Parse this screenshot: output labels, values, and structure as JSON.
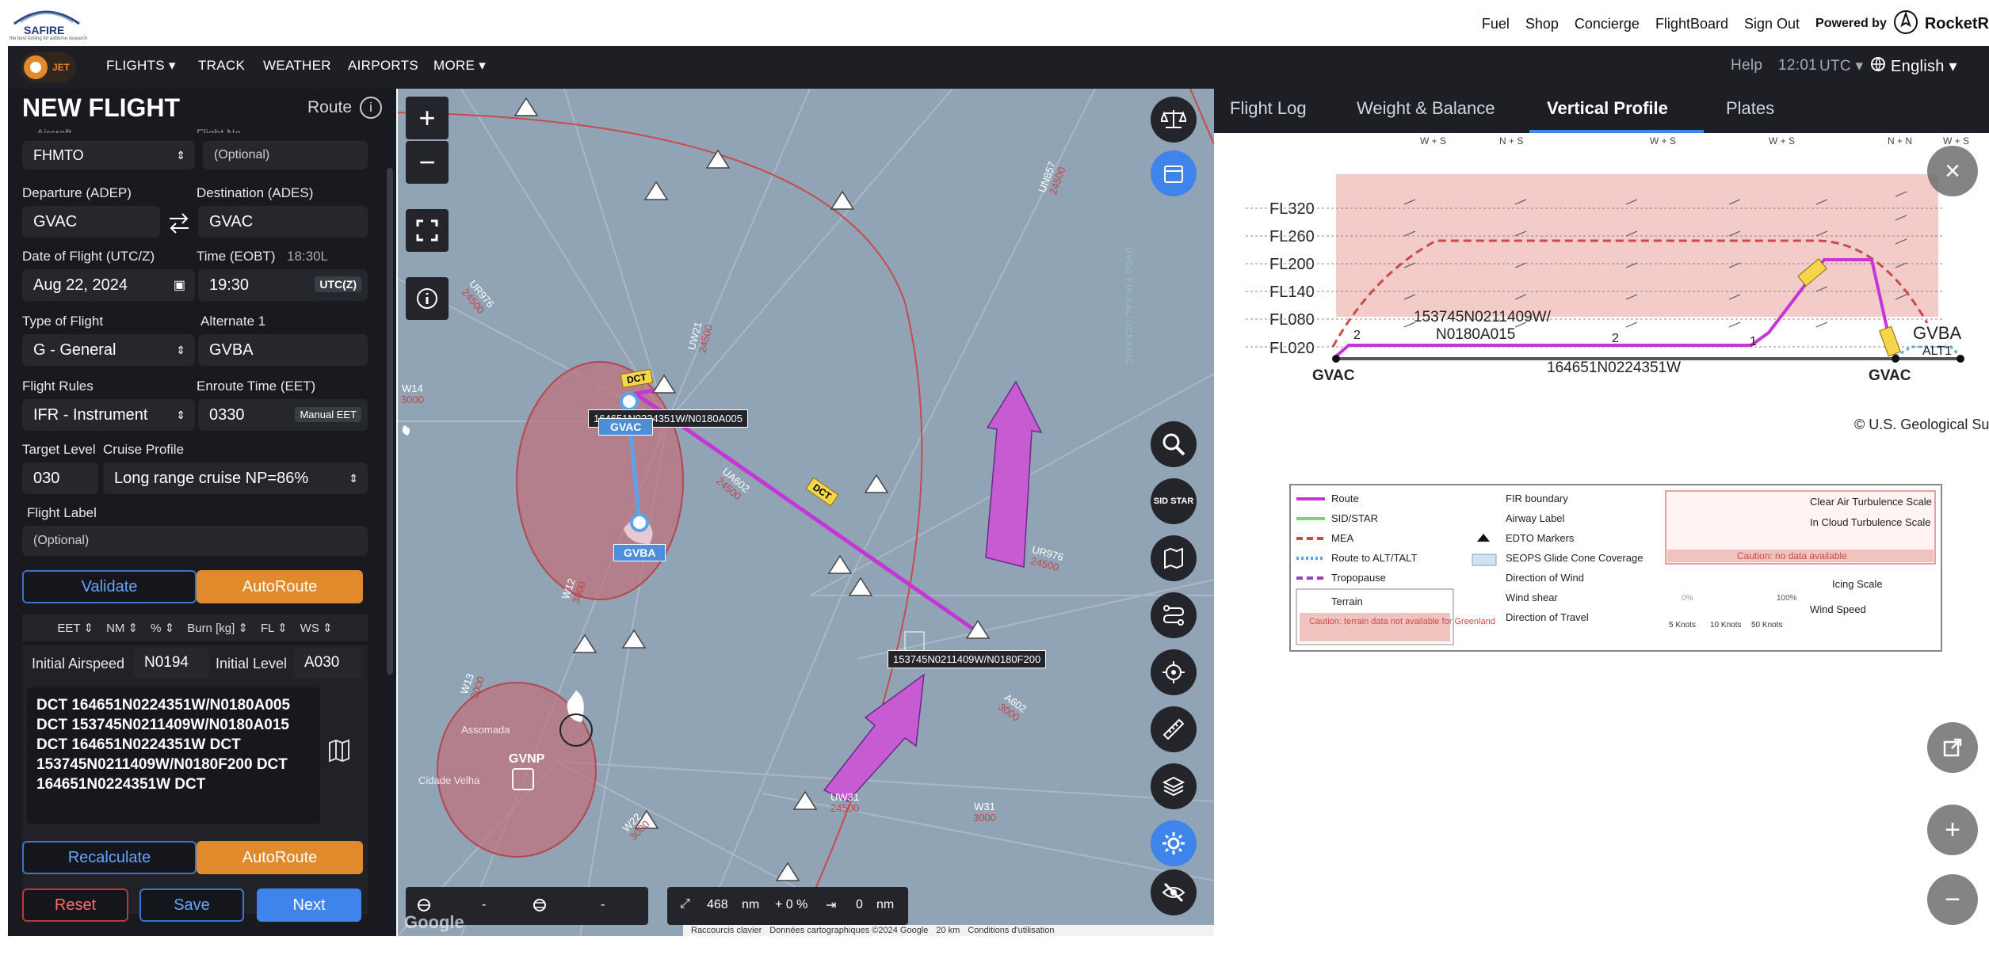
{
  "header": {
    "logo_text": "SAFIRE",
    "logo_sub": "the best tooling for airborne research",
    "links": [
      "Fuel",
      "Shop",
      "Concierge",
      "FlightBoard",
      "Sign Out"
    ],
    "powered_by": "Powered by",
    "brand": "RocketR"
  },
  "nav": {
    "logo_label": "JET",
    "items": [
      "FLIGHTS ▾",
      "TRACK",
      "WEATHER",
      "AIRPORTS",
      "MORE ▾"
    ],
    "help": "Help",
    "time": "12:01",
    "tz": "UTC ▾",
    "language": "English ▾"
  },
  "form": {
    "title": "NEW FLIGHT",
    "route_label": "Route",
    "aircraft_label": "Aircraft",
    "aircraft": "FHMTO",
    "flightno_label": "Flight No",
    "flightno_placeholder": "(Optional)",
    "departure_label": "Departure (ADEP)",
    "departure": "GVAC",
    "destination_label": "Destination (ADES)",
    "destination": "GVAC",
    "date_label": "Date of Flight (UTC/Z)",
    "date": "Aug 22, 2024",
    "time_label": "Time (EOBT)",
    "time_local": "18:30L",
    "time": "19:30",
    "time_unit": "UTC(Z)",
    "type_label": "Type of Flight",
    "type": "G - General",
    "alternate_label": "Alternate 1",
    "alternate": "GVBA",
    "rules_label": "Flight Rules",
    "rules": "IFR - Instrument",
    "eet_label": "Enroute Time (EET)",
    "eet": "0330",
    "eet_manual": "Manual EET",
    "target_label": "Target Level",
    "cruise_label": "Cruise Profile",
    "target": "030",
    "cruise": "Long range cruise NP=86%",
    "flightlabel_label": "Flight Label",
    "flightlabel_placeholder": "(Optional)",
    "validate": "Validate",
    "autoroute": "AutoRoute",
    "columns": [
      "EET ⇕",
      "NM ⇕",
      "% ⇕",
      "Burn [kg] ⇕",
      "FL ⇕",
      "WS ⇕"
    ],
    "airspeed_label": "Initial Airspeed",
    "airspeed": "N0194",
    "level_label": "Initial Level",
    "level": "A030",
    "route_text": "DCT 164651N0224351W/N0180A005 DCT 153745N0211409W/N0180A015 DCT 164651N0224351W DCT 153745N0211409W/N0180F200 DCT 164651N0224351W DCT",
    "recalculate": "Recalculate",
    "autoroute2": "AutoRoute",
    "reset": "Reset",
    "save": "Save",
    "next": "Next"
  },
  "map": {
    "gvac": "GVAC",
    "gvba": "GVBA",
    "gvnp": "GVNP",
    "wp_label_1": "164651N0224351W/N0180A005",
    "wp_label_2": "153745N0211409W/N0180F200",
    "dct": "DCT",
    "fir_label": "GVSC FIR SAL OCEANIC",
    "bottom_left": {
      "a": "-",
      "b": "-"
    },
    "distance": "468",
    "distance_unit": "nm",
    "pct": "+ 0 %",
    "nm2": "0",
    "nm2_unit": "nm",
    "attribution": [
      "Raccourcis clavier",
      "Données cartographiques ©2024 Google",
      "20 km",
      "Conditions d'utilisation"
    ],
    "google": "Google",
    "sidstar": "SID STAR",
    "airways": [
      {
        "id": "UN857",
        "alt": "24500"
      },
      {
        "id": "UR976",
        "alt": "24500"
      },
      {
        "id": "UW21",
        "alt": "24500"
      },
      {
        "id": "W14",
        "alt": "3000"
      },
      {
        "id": "UA602",
        "alt": "24500"
      },
      {
        "id": "W12",
        "alt": "3000"
      },
      {
        "id": "UR976",
        "alt": "24500"
      },
      {
        "id": "A602",
        "alt": "3000"
      },
      {
        "id": "UW31",
        "alt": "24500"
      },
      {
        "id": "W31",
        "alt": "3000"
      },
      {
        "id": "W13",
        "alt": "3000"
      },
      {
        "id": "W22",
        "alt": "3000"
      }
    ],
    "places": [
      "Assomada",
      "Cidade Velha"
    ]
  },
  "profile": {
    "tabs": [
      "Flight Log",
      "Weight & Balance",
      "Vertical Profile",
      "Plates"
    ],
    "active_tab": "Vertical Profile",
    "levels": [
      "FL320",
      "FL260",
      "FL200",
      "FL140",
      "FL080",
      "FL020"
    ],
    "wp_a": "153745N0211409W/",
    "wp_a2": "N0180A015",
    "wp_b": "164651N0224351W",
    "start": "GVAC",
    "end": "GVAC",
    "alt": "GVBA",
    "alt1": "ALT1",
    "credit": "© U.S. Geological Su",
    "counts": [
      "2",
      "2",
      "1"
    ],
    "legend": {
      "col1": [
        "Route",
        "SID/STAR",
        "MEA",
        "Route to ALT/TALT",
        "Tropopause",
        "Terrain"
      ],
      "terrain_note": "Caution: terrain data not available for Greenland",
      "col2": [
        "FIR boundary",
        "Airway Label",
        "EDTO Markers",
        "SEOPS Glide Cone Coverage",
        "Direction of Wind",
        "Wind shear",
        "Direction of Travel"
      ],
      "col3": [
        "Clear Air Turbulence Scale",
        "In Cloud Turbulence Scale",
        "Caution: no data available",
        "Icing Scale",
        "Wind Speed"
      ],
      "icing_pct": [
        "0%",
        "100%"
      ],
      "wind_units": [
        "5 Knots",
        "10 Knots",
        "50 Knots"
      ]
    }
  },
  "colors": {
    "accent": "#e08a2c",
    "route": "#c636d6",
    "primary": "#3f84ea",
    "panel": "#181a1f",
    "map": "#91a4b6"
  }
}
